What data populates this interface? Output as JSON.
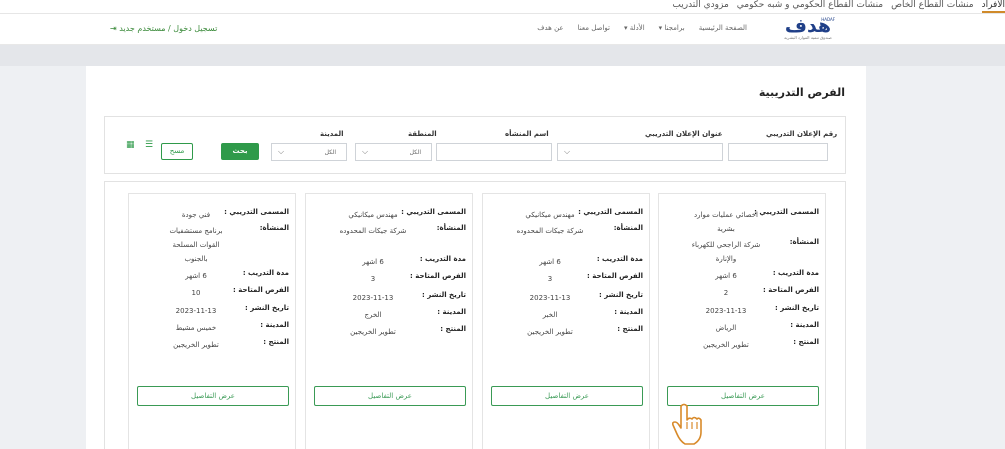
{
  "topbar": {
    "links": [
      "الأفراد",
      "منشآت القطاع الخاص",
      "منشآت القطاع الحكومي و شبه حكومي",
      "مزودي التدريب"
    ]
  },
  "header": {
    "logo_text": "هدف",
    "logo_tag": "HADAF",
    "logo_sub": "صندوق تنمية الموارد البشرية",
    "nav": [
      "الصفحة الرئيسية",
      "برامجنا",
      "الأدلة",
      "تواصل معنا",
      "عن هدف"
    ],
    "login": "تسجيل دخول / مستخدم جديد"
  },
  "page": {
    "title": "الفرص التدريبية"
  },
  "filters": {
    "number_label": "رقم الإعلان التدريبي",
    "ad_title_label": "عنوان الإعلان التدريبي",
    "org_label": "اسم المنشأه",
    "region_label": "المنطقة",
    "city_label": "المدينة",
    "region_value": "الكل",
    "city_value": "الكل",
    "search_button": "بحث",
    "clear_button": "مسح"
  },
  "cards": [
    {
      "title_key": "المسمى التدريبي :",
      "title": "اخصائي عمليات موارد بشرية",
      "org_key": "المنشأة:",
      "org": "شركة الراجحي للكهرباء والإنارة",
      "duration_key": "مدة التدريب :",
      "duration": "6 اشهر",
      "seats_key": "الفرص المتاحة :",
      "seats": "2",
      "date_key": "تاريخ النشر :",
      "date": "2023-11-13",
      "city_key": "المدينة :",
      "city": "الرياض",
      "product_key": "المنتج :",
      "product": "تطوير الخريجين",
      "details": "عرض التفاصيل"
    },
    {
      "title_key": "المسمى التدريبي :",
      "title": "مهندس ميكانيكي",
      "org_key": "المنشأة:",
      "org": "شركة جيكات المحدوده",
      "duration_key": "مدة التدريب :",
      "duration": "6 اشهر",
      "seats_key": "الفرص المتاحة :",
      "seats": "3",
      "date_key": "تاريخ النشر :",
      "date": "2023-11-13",
      "city_key": "المدينة :",
      "city": "الخبر",
      "product_key": "المنتج :",
      "product": "تطوير الخريجين",
      "details": "عرض التفاصيل"
    },
    {
      "title_key": "المسمى التدريبي :",
      "title": "مهندس ميكانيكي",
      "org_key": "المنشأة:",
      "org": "شركة جيكات المحدوده",
      "duration_key": "مدة التدريب :",
      "duration": "6 اشهر",
      "seats_key": "الفرص المتاحة :",
      "seats": "3",
      "date_key": "تاريخ النشر :",
      "date": "2023-11-13",
      "city_key": "المدينة :",
      "city": "الخرج",
      "product_key": "المنتج :",
      "product": "تطوير الخريجين",
      "details": "عرض التفاصيل"
    },
    {
      "title_key": "المسمى التدريبي :",
      "title": "فني جودة",
      "org_key": "المنشأة:",
      "org": "برنامج مستشفيات القوات المسلحة بالجنوب",
      "duration_key": "مدة التدريب :",
      "duration": "6 اشهر",
      "seats_key": "الفرص المتاحة :",
      "seats": "10",
      "date_key": "تاريخ النشر :",
      "date": "2023-11-13",
      "city_key": "المدينة :",
      "city": "خميس مشيط",
      "product_key": "المنتج :",
      "product": "تطوير الخريجين",
      "details": "عرض التفاصيل"
    }
  ],
  "icons": {
    "grid": "grid-view-icon",
    "list": "list-view-icon",
    "login": "login-icon",
    "cursor": "hand-cursor-icon"
  },
  "colors": {
    "brand_green": "#2f9a4a",
    "brand_blue": "#1f3f88",
    "active_underline": "#d08a2a"
  }
}
